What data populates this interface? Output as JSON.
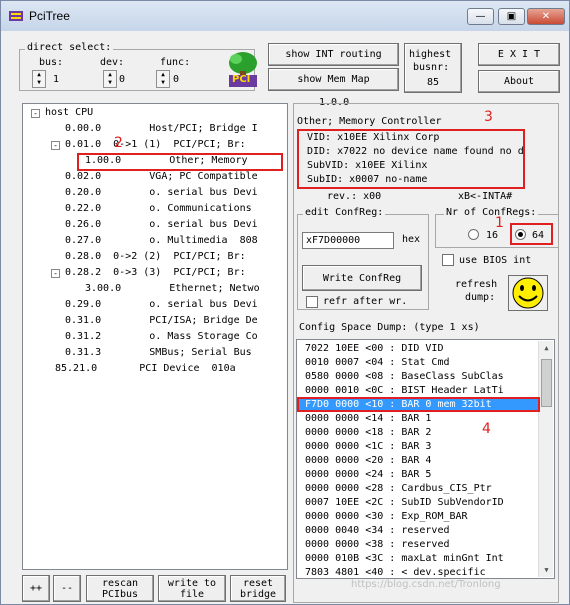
{
  "window": {
    "title": "PciTree",
    "minimize_glyph": "—",
    "restore_glyph": "▣",
    "close_glyph": "✕"
  },
  "direct_select": {
    "title": "direct select:",
    "bus_label": "bus:",
    "bus_value": "1",
    "dev_label": "dev:",
    "dev_value": "0",
    "func_label": "func:",
    "func_value": "0"
  },
  "toolbar": {
    "show_int_routing": "show INT routing",
    "show_mem_map": "show Mem Map",
    "highest_busnr_line1": "highest",
    "highest_busnr_line2": "busnr:",
    "highest_busnr_value": "85",
    "exit": "E X I T",
    "about": "About",
    "logo_text": "PCI"
  },
  "tree": {
    "root": "host CPU",
    "rows": [
      {
        "text": "0.00.0        Host/PCI; Bridge I",
        "expander": ""
      },
      {
        "text": "0.01.0  0->1 (1)  PCI/PCI; Br:",
        "expander": "-"
      },
      {
        "text": "1.00.0        Other; Memory ",
        "expander": ""
      },
      {
        "text": "0.02.0        VGA; PC Compatible",
        "expander": ""
      },
      {
        "text": "0.20.0        o. serial bus Devi",
        "expander": ""
      },
      {
        "text": "0.22.0        o. Communications ",
        "expander": ""
      },
      {
        "text": "0.26.0        o. serial bus Devi",
        "expander": ""
      },
      {
        "text": "0.27.0        o. Multimedia  808",
        "expander": ""
      },
      {
        "text": "0.28.0  0->2 (2)  PCI/PCI; Br:",
        "expander": ""
      },
      {
        "text": "0.28.2  0->3 (3)  PCI/PCI; Br:",
        "expander": "-"
      },
      {
        "text": "3.00.0        Ethernet; Netwo",
        "expander": ""
      },
      {
        "text": "0.29.0        o. serial bus Devi",
        "expander": ""
      },
      {
        "text": "0.31.0        PCI/ISA; Bridge De",
        "expander": ""
      },
      {
        "text": "0.31.2        o. Mass Storage Co",
        "expander": ""
      },
      {
        "text": "0.31.3        SMBus; Serial Bus ",
        "expander": ""
      },
      {
        "text": "85.21.0       PCI Device  010a",
        "expander": ""
      }
    ]
  },
  "bottom_buttons": {
    "expand": "++",
    "collapse": "--",
    "rescan_1": "rescan",
    "rescan_2": "PCIbus",
    "write_1": "write to",
    "write_2": "file",
    "reset_1": "reset",
    "reset_2": "bridge"
  },
  "device_info": {
    "bdf": "1.0.0",
    "class_line": "Other; Memory Controller",
    "vid": "VID: x10EE Xilinx Corp",
    "did": "DID: x7022 no device name found no d",
    "subvid": "SubVID: x10EE Xilinx",
    "subid": "SubID: x0007 no-name",
    "rev": "rev.: x00",
    "inta": "xB<-INTA#"
  },
  "edit_confreg": {
    "title": "edit ConfReg:",
    "value": "xF7D00000",
    "hex_label": "hex",
    "write_button": "Write ConfReg",
    "refr_label": "refr after wr."
  },
  "nr_confregs": {
    "title": "Nr of ConfRegs:",
    "opt16": "16",
    "opt64": "64"
  },
  "bios": {
    "use_bios_label": "use BIOS int",
    "refresh_1": "refresh",
    "refresh_2": "dump:"
  },
  "dump": {
    "title": "Config Space Dump: (type 1 xs)",
    "rows": [
      "7022 10EE <00 : DID VID",
      "0010 0007 <04 : Stat Cmd",
      "0580 0000 <08 : BaseClass SubClas",
      "0000 0010 <0C : BIST Header LatTi",
      "F7D0 0000 <10 : BAR 0 mem 32bit",
      "0000 0000 <14 : BAR 1",
      "0000 0000 <18 : BAR 2",
      "0000 0000 <1C : BAR 3",
      "0000 0000 <20 : BAR 4",
      "0000 0000 <24 : BAR 5",
      "0000 0000 <28 : Cardbus_CIS_Ptr",
      "0007 10EE <2C : SubID SubVendorID",
      "0000 0000 <30 : Exp_ROM_BAR",
      "0000 0040 <34 : reserved",
      "0000 0000 <38 : reserved",
      "0000 010B <3C : maxLat minGnt Int",
      "7803 4801 <40 : < dev.specific"
    ],
    "selected_index": 4
  },
  "annotations": {
    "n1": "1",
    "n2": "2",
    "n3": "3",
    "n4": "4"
  },
  "watermark": "https://blog.csdn.net/Tronlong",
  "colors": {
    "selection": "#3399ff",
    "annotation": "#e02020"
  }
}
